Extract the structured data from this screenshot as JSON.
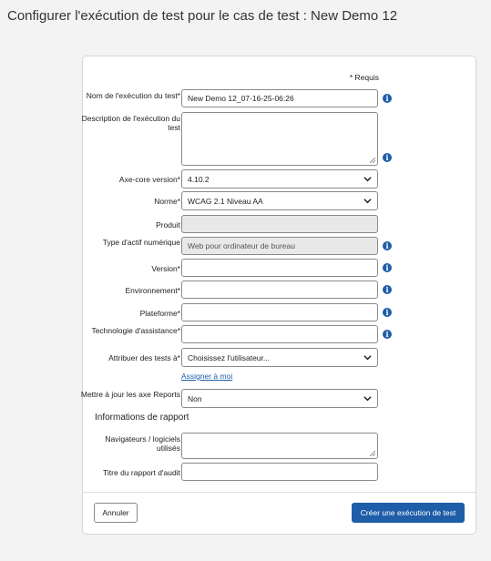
{
  "page": {
    "title": "Configurer l'exécution de test pour le cas de test : New Demo 12"
  },
  "form": {
    "required_note": "* Requis",
    "name": {
      "label": "Nom de l'exécution du test*",
      "value": "New Demo 12_07-16-25-06:26"
    },
    "description": {
      "label": "Description de l'exécution du test",
      "value": ""
    },
    "axe_core_version": {
      "label": "Axe-core version*",
      "value": "4.10.2"
    },
    "norme": {
      "label": "Norme*",
      "value": "WCAG 2.1 Niveau AA"
    },
    "produit": {
      "label": "Produit",
      "value": ""
    },
    "type_actif": {
      "label": "Type d'actif numérique",
      "value": "Web pour ordinateur de bureau"
    },
    "version": {
      "label": "Version*",
      "value": ""
    },
    "environnement": {
      "label": "Environnement*",
      "value": ""
    },
    "plateforme": {
      "label": "Plateforme*",
      "value": ""
    },
    "technologie": {
      "label": "Technologie d'assistance*",
      "value": ""
    },
    "attribuer": {
      "label": "Attribuer des tests à*",
      "value": "Choisissez l'utilisateur..."
    },
    "assigner_link": "Assigner à moi",
    "mettre_a_jour": {
      "label": "Mettre à jour les axe Reports",
      "value": "Non"
    },
    "report_section_title": "Informations de rapport",
    "navigateurs": {
      "label": "Navigateurs / logiciels utilisés",
      "value": ""
    },
    "titre_rapport": {
      "label": "Titre du rapport d'audit",
      "value": ""
    }
  },
  "footer": {
    "cancel_label": "Annuler",
    "create_label": "Créer une exécution de test"
  },
  "colors": {
    "accent": "#1e5da8",
    "disabled_bg": "#e8e8e8"
  },
  "icons": {
    "info": "info-icon",
    "dropdown": "chevron-down-icon"
  }
}
